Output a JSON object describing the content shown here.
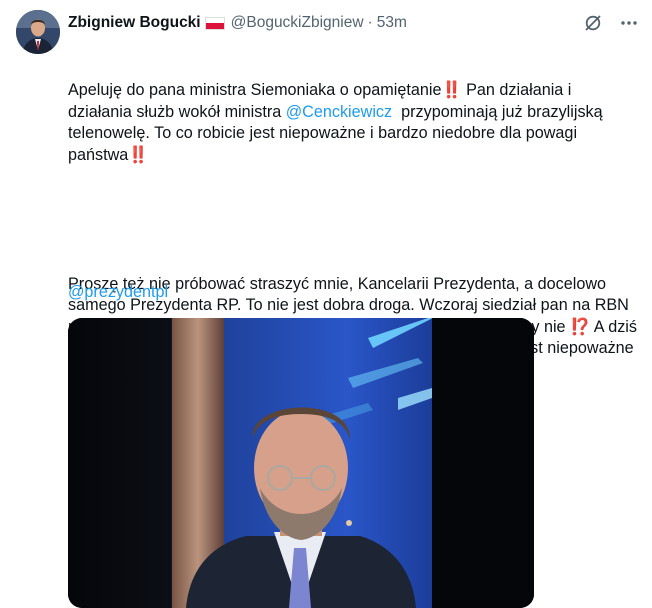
{
  "author": {
    "name": "Zbigniew Bogucki",
    "handle": "@BoguckiZbigniew",
    "separator": "·",
    "time": "53m",
    "flag": "poland-flag"
  },
  "icons": {
    "grok": "grok-icon",
    "more": "more-icon"
  },
  "tweet": {
    "p1_a": "Apeluję do pana ministra Siemoniaka o opamiętanie",
    "p1_emoji1": "‼️",
    "p1_b": " Pan działania i działania służb wokół ministra ",
    "p1_mention": "@Cenckiewicz",
    "p1_c": "  przypominają już brazylijską telenowelę. To co robicie jest niepoważne i bardzo niedobre dla powagi państwa",
    "p1_emoji2": "‼️",
    "p2_a": "Proszę też nie próbować straszyć mnie, Kancelarii Prezydenta, a docelowo samego Prezydenta RP. To nie jest dobra droga. Wczoraj siedział pan na RBN przez 6 godzin, to co nie wiedział pan czy może uczestniczyć, czy nie ",
    "p2_emoji": "⁉️",
    "p2_b": " A dziś rano serwuje nam pan zapowiedzi kontroli ABW.  To co robicie jest niepoważne i bardzo niedobre dla powagi państwa",
    "tag": "@prezydentpl"
  },
  "colors": {
    "link": "#1d9bf0",
    "muted": "#536471",
    "emoji_red": "#e0245e"
  }
}
